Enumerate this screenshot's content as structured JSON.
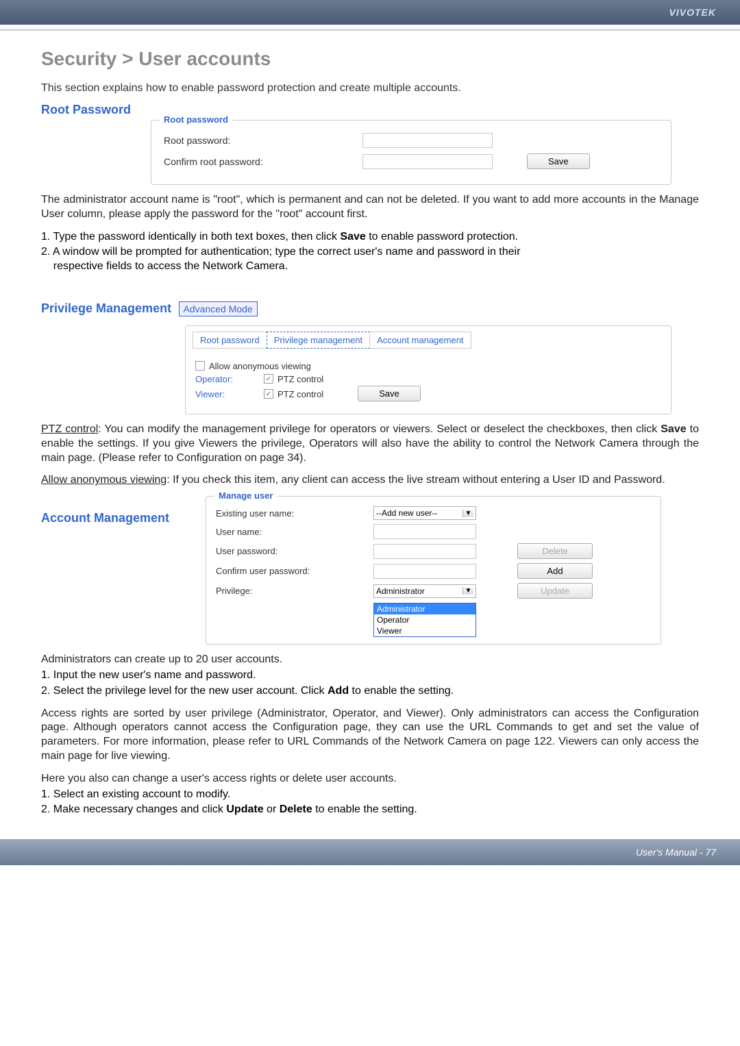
{
  "brand": "VIVOTEK",
  "page_title": "Security > User accounts",
  "intro": "This section explains how to enable password protection and create multiple accounts.",
  "sections": {
    "root_password": {
      "title": "Root Password",
      "legend": "Root password",
      "fields": {
        "root_pw_label": "Root password:",
        "confirm_pw_label": "Confirm root password:"
      },
      "save_btn": "Save"
    },
    "root_text1": "The administrator account name is \"root\", which is permanent and can not be deleted. If you want to add more accounts in the Manage User column, please apply the password for the \"root\" account first.",
    "root_step1": "1. Type the password identically in both text boxes, then click Save to enable password protection.",
    "root_step2": "2. A window will be prompted for authentication; type the correct user's name and password in their respective fields to access the Network Camera.",
    "privilege_mgmt": {
      "title": "Privilege Management",
      "adv_mode": "Advanced Mode",
      "tabs": {
        "root": "Root password",
        "priv": "Privilege management",
        "acct": "Account management"
      },
      "allow_anon": "Allow anonymous viewing",
      "operator": "Operator:",
      "viewer": "Viewer:",
      "ptz": "PTZ control",
      "save_btn": "Save"
    },
    "ptz_text": "PTZ control: You can modify the management privilege for operators or viewers. Select or deselect the checkboxes, then click Save to enable the settings. If you give Viewers the privilege, Operators will also have the ability to control the Network Camera through the main page. (Please refer to Configuration on page 34).",
    "anon_text": "Allow anonymous viewing: If you check this item, any client can access the live stream without entering a User ID and Password.",
    "acct_mgmt": {
      "title": "Account Management",
      "legend": "Manage user",
      "existing_label": "Existing user name:",
      "existing_value": "--Add new user--",
      "username_label": "User name:",
      "userpw_label": "User password:",
      "confirmpw_label": "Confirm user password:",
      "privilege_label": "Privilege:",
      "privilege_value": "Administrator",
      "options": {
        "admin": "Administrator",
        "operator": "Operator",
        "viewer": "Viewer"
      },
      "delete_btn": "Delete",
      "add_btn": "Add",
      "update_btn": "Update"
    },
    "admin_text1": "Administrators can create up to 20 user accounts.",
    "admin_step1": "1. Input the new user's name and password.",
    "admin_step2": "2. Select the privilege level for the new user account. Click Add to enable the setting.",
    "access_text": "Access rights are sorted by user privilege (Administrator, Operator, and Viewer). Only administrators can access the Configuration page. Although operators cannot access the Configuration page, they can use the URL Commands to get and set the value of parameters. For more information, please refer to URL Commands of the Network Camera on page 122. Viewers can only access the main page for live viewing.",
    "change_text": "Here you also can change a user's access rights or delete user accounts.",
    "change_step1": "1. Select an existing account to modify.",
    "change_step2": "2. Make necessary changes and click Update or Delete to enable the setting."
  },
  "footer": "User's Manual - 77"
}
